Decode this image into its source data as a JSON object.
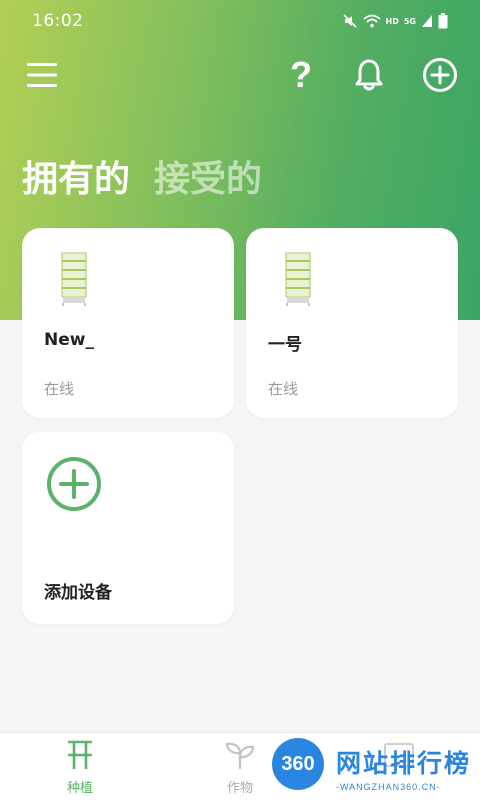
{
  "status_bar": {
    "time": "16:02",
    "icons": [
      "mute-icon",
      "wifi-icon",
      "hd-icon",
      "signal-icon",
      "battery-icon"
    ],
    "hd_label": "HD",
    "network_label": "5G"
  },
  "toolbar": {
    "help_label": "?",
    "icons": [
      "menu-icon",
      "help-icon",
      "bell-icon",
      "plus-circle-icon"
    ]
  },
  "tabs": [
    {
      "label": "拥有的",
      "active": true
    },
    {
      "label": "接受的",
      "active": false
    }
  ],
  "devices": [
    {
      "name": "New_",
      "status": "在线"
    },
    {
      "name": "一号",
      "status": "在线"
    }
  ],
  "add_device": {
    "label": "添加设备"
  },
  "bottom_nav": [
    {
      "label": "种植",
      "icon": "planter-icon",
      "active": true
    },
    {
      "label": "作物",
      "icon": "sprout-icon",
      "active": false
    }
  ],
  "watermark": {
    "badge": "360",
    "title": "网站排行榜",
    "subtitle": "-WANGZHAN360.CN-"
  },
  "colors": {
    "gradient_start": "#b3cf55",
    "gradient_end": "#3aa564",
    "accent_green": "#5bb26a",
    "watermark_blue": "#2a85e0"
  }
}
